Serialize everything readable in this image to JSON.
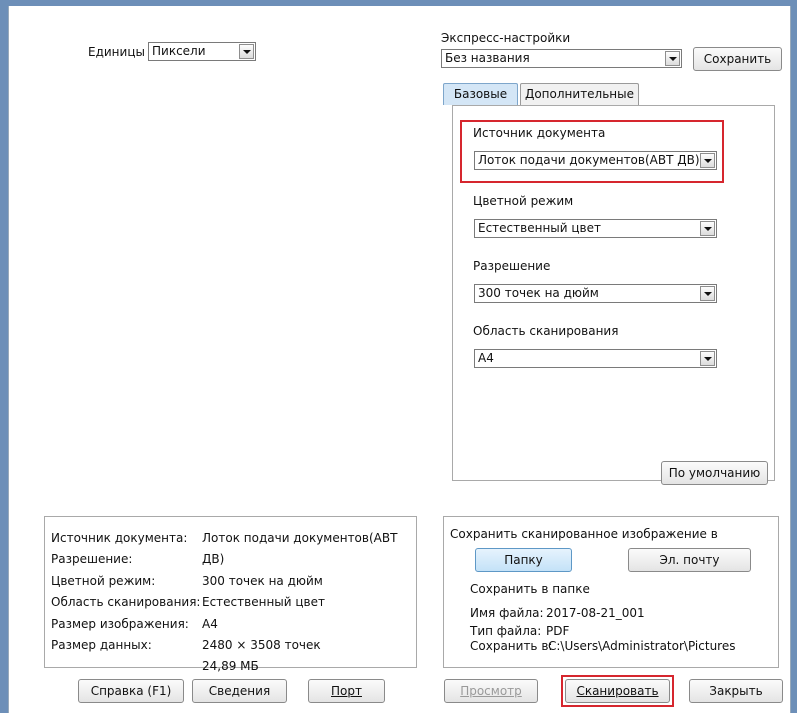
{
  "units": {
    "label": "Единицы",
    "value": "Пиксели"
  },
  "express": {
    "label": "Экспресс-настройки",
    "value": "Без названия",
    "save_button": "Сохранить"
  },
  "tabs": {
    "basic": "Базовые",
    "advanced": "Дополнительные"
  },
  "basic": {
    "source_label": "Источник документа",
    "source_value": "Лоток подачи документов(АВТ ДВ)",
    "color_label": "Цветной режим",
    "color_value": "Естественный цвет",
    "resolution_label": "Разрешение",
    "resolution_value": "300 точек на дюйм",
    "area_label": "Область сканирования",
    "area_value": "A4",
    "default_button": "По умолчанию"
  },
  "summary": {
    "rows": [
      {
        "label": "Источник документа:",
        "value": "Лоток подачи документов(АВТ ДВ)"
      },
      {
        "label": "Разрешение:",
        "value": "300 точек на дюйм"
      },
      {
        "label": "Цветной режим:",
        "value": "Естественный цвет"
      },
      {
        "label": "Область сканирования:",
        "value": "A4"
      },
      {
        "label": "Размер изображения:",
        "value": "2480 × 3508 точек"
      },
      {
        "label": "Размер данных:",
        "value": "24,89 МБ"
      }
    ]
  },
  "save": {
    "title": "Сохранить сканированное изображение в",
    "folder_button": "Папку",
    "email_button": "Эл. почту",
    "save_in_folder": "Сохранить в папке",
    "filename_label": "Имя файла:",
    "filename_value": "2017-08-21_001",
    "filetype_label": "Тип файла:",
    "filetype_value": "PDF",
    "savein_label": "Сохранить в:",
    "savein_value": "C:\\Users\\Administrator\\Pictures"
  },
  "buttons": {
    "help": "Справка (F1)",
    "info": "Сведения",
    "port": "Порт",
    "preview": "Просмотр",
    "scan": "Сканировать",
    "close": "Закрыть"
  },
  "colors": {
    "highlight_red": "#d6262e",
    "frame_bg": "#6d8fb8"
  }
}
